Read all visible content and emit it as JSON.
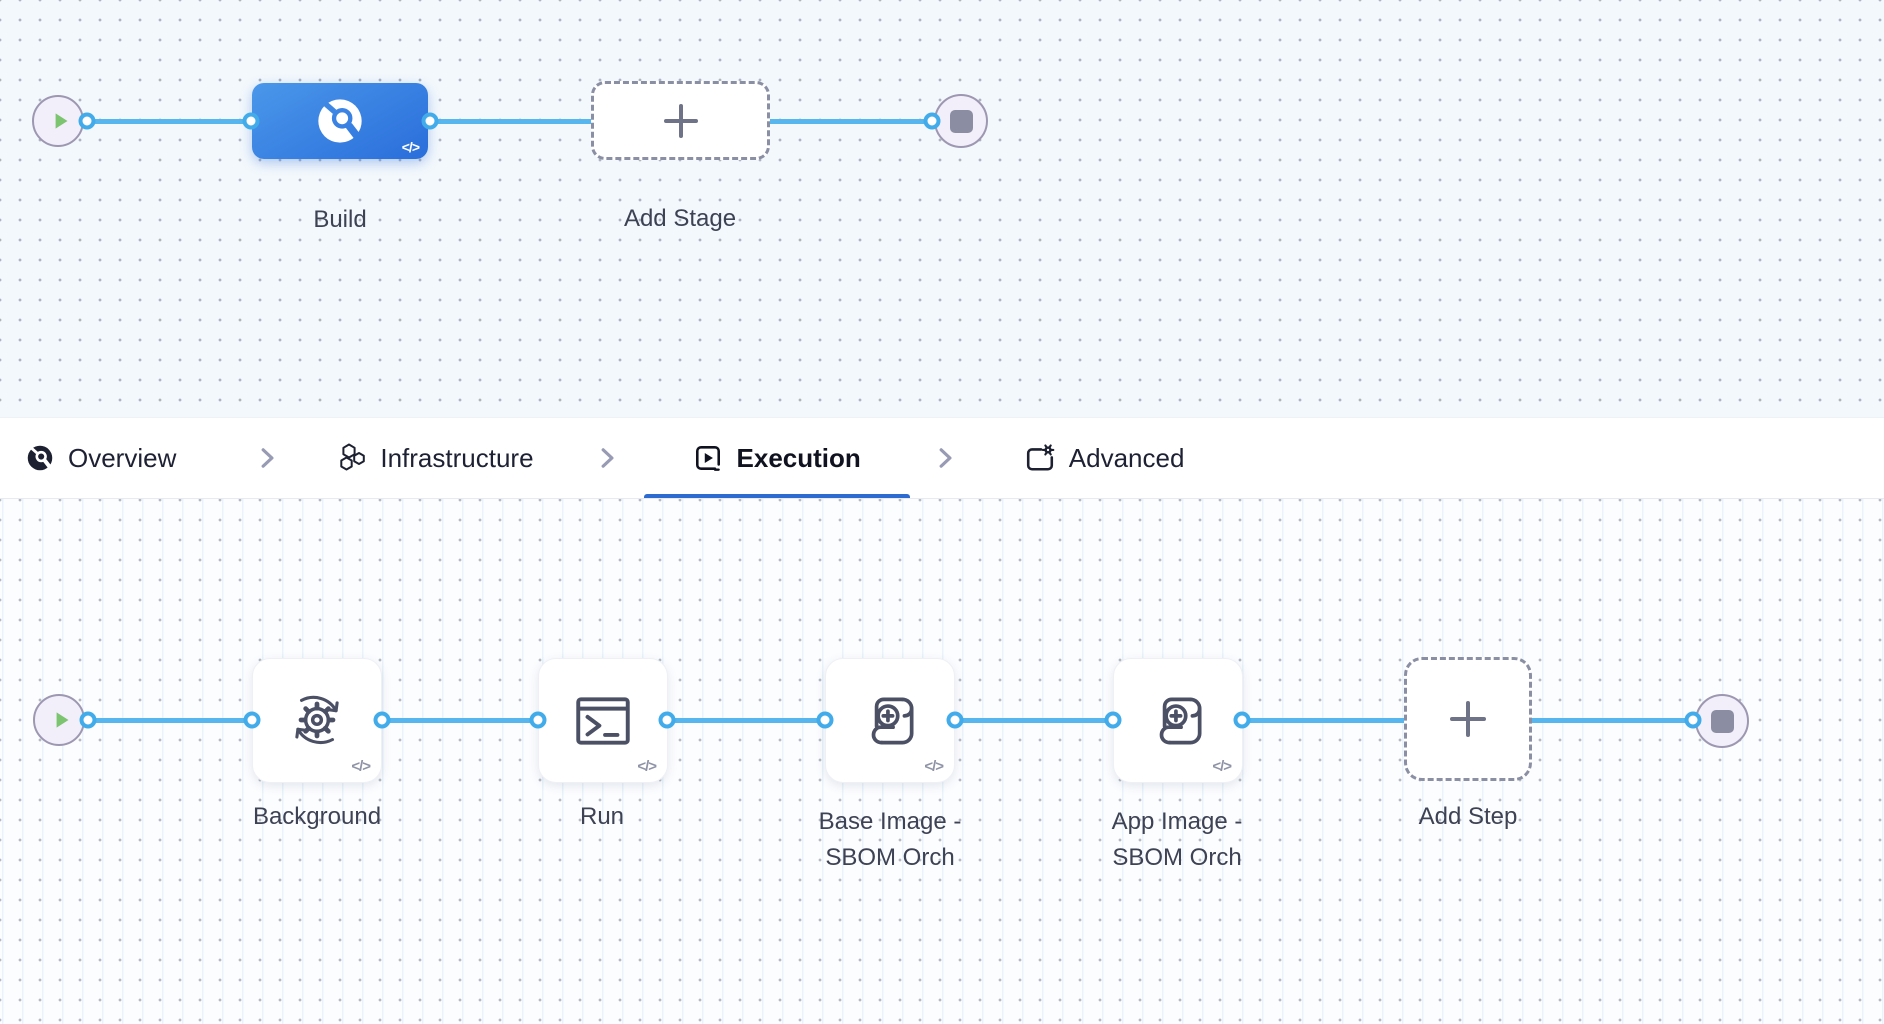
{
  "stage_flow": {
    "stages": [
      {
        "label": "Build"
      }
    ],
    "add_label": "Add Stage"
  },
  "tab_bar": {
    "tabs": [
      {
        "label": "Overview",
        "active": false
      },
      {
        "label": "Infrastructure",
        "active": false
      },
      {
        "label": "Execution",
        "active": true
      },
      {
        "label": "Advanced",
        "active": false
      }
    ]
  },
  "exec_flow": {
    "steps": [
      {
        "label": "Background"
      },
      {
        "label": "Run"
      },
      {
        "label": "Base Image -\nSBOM Orch"
      },
      {
        "label": "App Image -\nSBOM Orch"
      }
    ],
    "add_label": "Add Step"
  },
  "badges": {
    "code": "</>"
  },
  "colors": {
    "flow_line": "#57b6ee",
    "connector_ring": "#42abea",
    "stage_node_gradient_start": "#4a97ea",
    "stage_node_gradient_end": "#2a6edb",
    "active_tab_underline": "#2e6bd0",
    "start_play": "#7cc470",
    "stop_square": "#8b8ea3",
    "canvas_top_bg": "#f3f8fc",
    "canvas_bottom_bg": "#fcfdff"
  }
}
